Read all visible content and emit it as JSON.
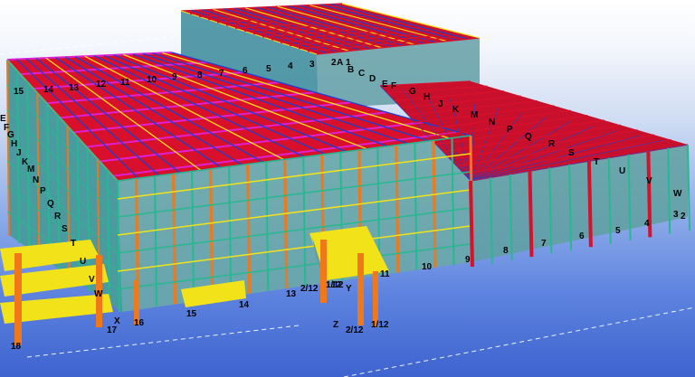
{
  "viewport": {
    "background_colors": [
      "#ffffff",
      "#93b0ea",
      "#3e63cf"
    ],
    "member_colors": {
      "roof_purlin": "#d8102c",
      "bracing": "#e020d0",
      "column": "#f07818",
      "beam": "#f2e21a",
      "girt": "#28b890",
      "frame": "#3a8a9a",
      "secondary": "#1a40d0",
      "grid_line": "#ffffff"
    }
  },
  "grid_labels": {
    "top_numbers": [
      "15",
      "14",
      "13",
      "12",
      "11",
      "10",
      "9",
      "8",
      "7",
      "6",
      "5",
      "4",
      "3",
      "2",
      "1"
    ],
    "top_letters": [
      "A",
      "B",
      "C",
      "D",
      "E",
      "F",
      "G",
      "H",
      "J",
      "K",
      "M",
      "N",
      "P",
      "Q",
      "R",
      "S",
      "T",
      "U",
      "V",
      "W"
    ],
    "left_letters": [
      "E",
      "F",
      "G",
      "H",
      "J",
      "K",
      "M",
      "N",
      "P",
      "Q",
      "R",
      "S",
      "T",
      "U",
      "V",
      "W"
    ],
    "bottom_numbers": [
      "18",
      "17",
      "16",
      "15",
      "14",
      "13",
      "12",
      "11",
      "10",
      "9",
      "8",
      "7",
      "6",
      "5",
      "4",
      "3",
      "2"
    ],
    "annex": [
      "2/12",
      "1/12",
      "Y",
      "Z",
      "X"
    ]
  }
}
